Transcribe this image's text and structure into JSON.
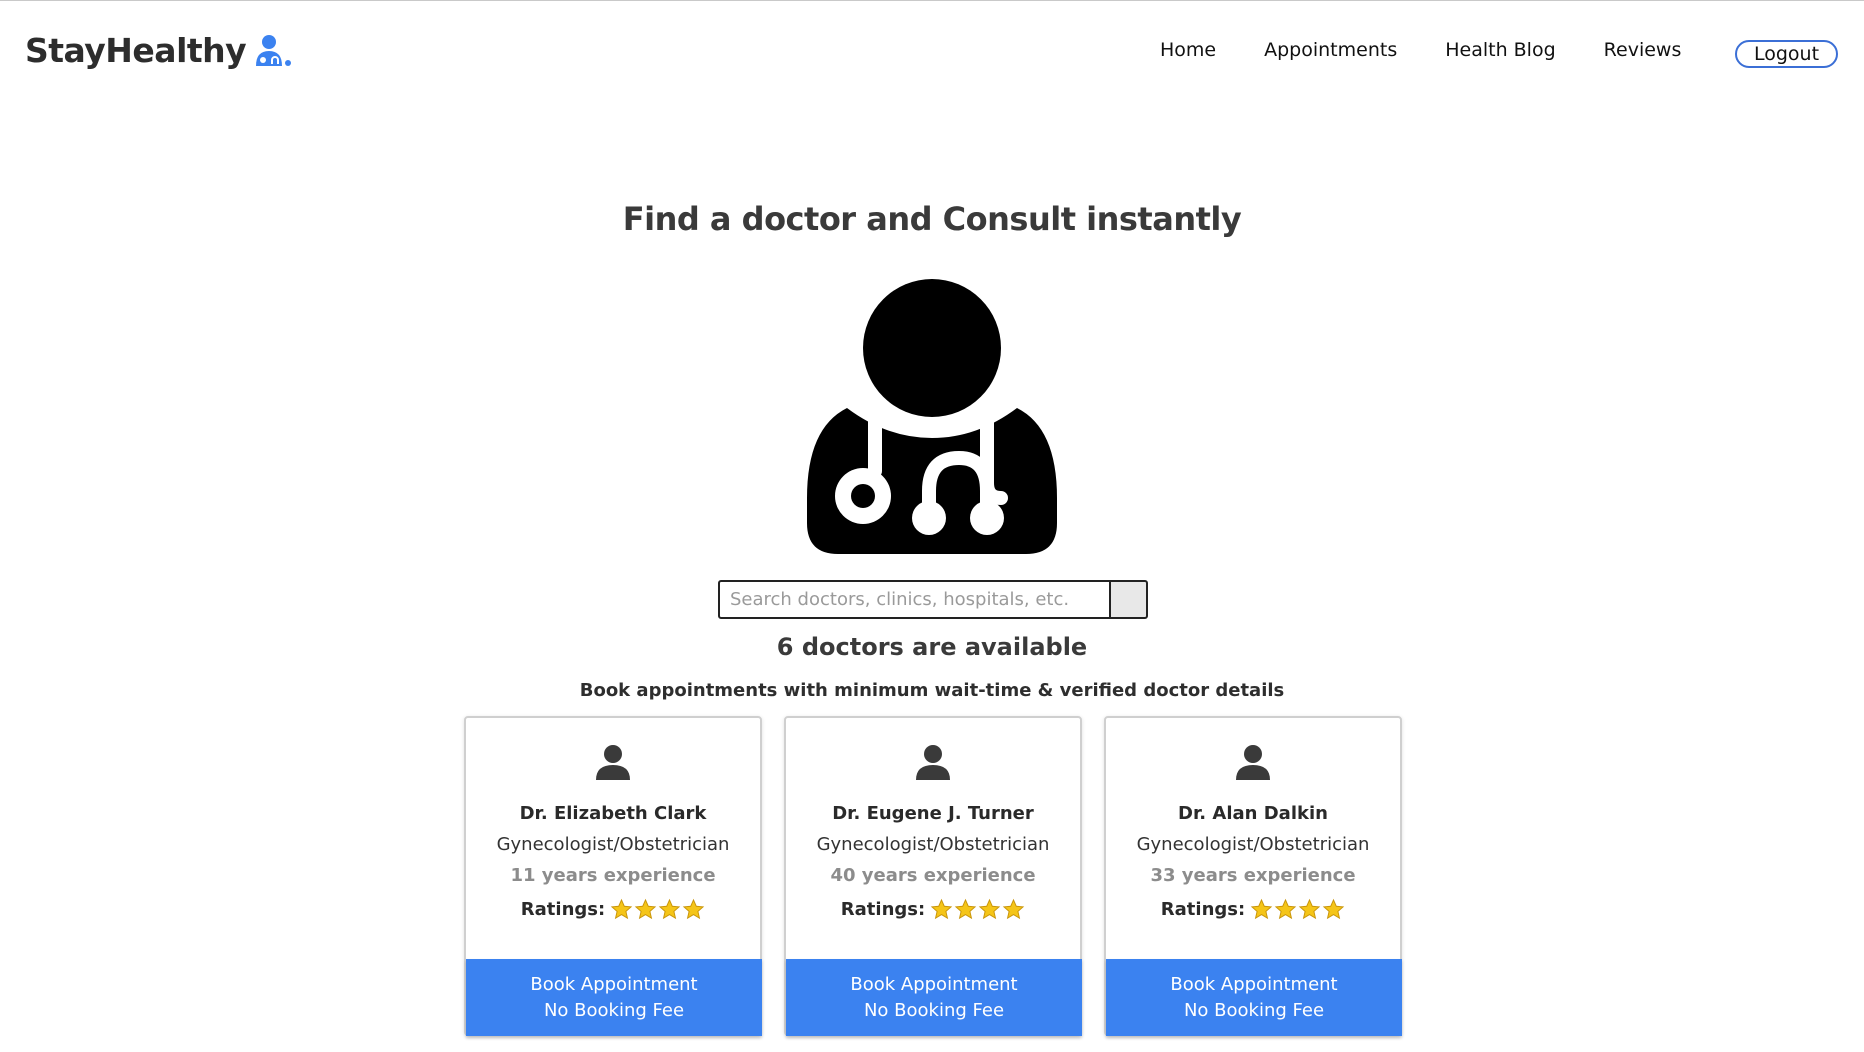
{
  "brand": {
    "name": "StayHealthy",
    "icon": "doctor-logo-icon",
    "accent": "#3b82f0"
  },
  "nav": {
    "items": [
      {
        "label": "Home"
      },
      {
        "label": "Appointments"
      },
      {
        "label": "Health Blog"
      },
      {
        "label": "Reviews"
      }
    ],
    "logout_label": "Logout"
  },
  "hero": {
    "title": "Find a doctor and Consult instantly",
    "illustration": "doctor-stethoscope-icon"
  },
  "search": {
    "placeholder": "Search doctors, clinics, hospitals, etc.",
    "value": "",
    "button_icon": "search-icon"
  },
  "results": {
    "count_text": "6 doctors are available",
    "subtitle": "Book appointments with minimum wait-time & verified doctor details"
  },
  "doctors": [
    {
      "name": "Dr. Elizabeth Clark",
      "speciality": "Gynecologist/Obstetrician",
      "experience": "11 years experience",
      "ratings_label": "Ratings:",
      "stars": 4,
      "book_line1": "Book Appointment",
      "book_line2": "No Booking Fee"
    },
    {
      "name": "Dr. Eugene J. Turner",
      "speciality": "Gynecologist/Obstetrician",
      "experience": "40 years experience",
      "ratings_label": "Ratings:",
      "stars": 4,
      "book_line1": "Book Appointment",
      "book_line2": "No Booking Fee"
    },
    {
      "name": "Dr. Alan Dalkin",
      "speciality": "Gynecologist/Obstetrician",
      "experience": "33 years experience",
      "ratings_label": "Ratings:",
      "stars": 4,
      "book_line1": "Book Appointment",
      "book_line2": "No Booking Fee"
    }
  ],
  "colors": {
    "button_blue": "#3b82f0",
    "logout_border": "#3b6fd6",
    "star": "#f5c518"
  }
}
